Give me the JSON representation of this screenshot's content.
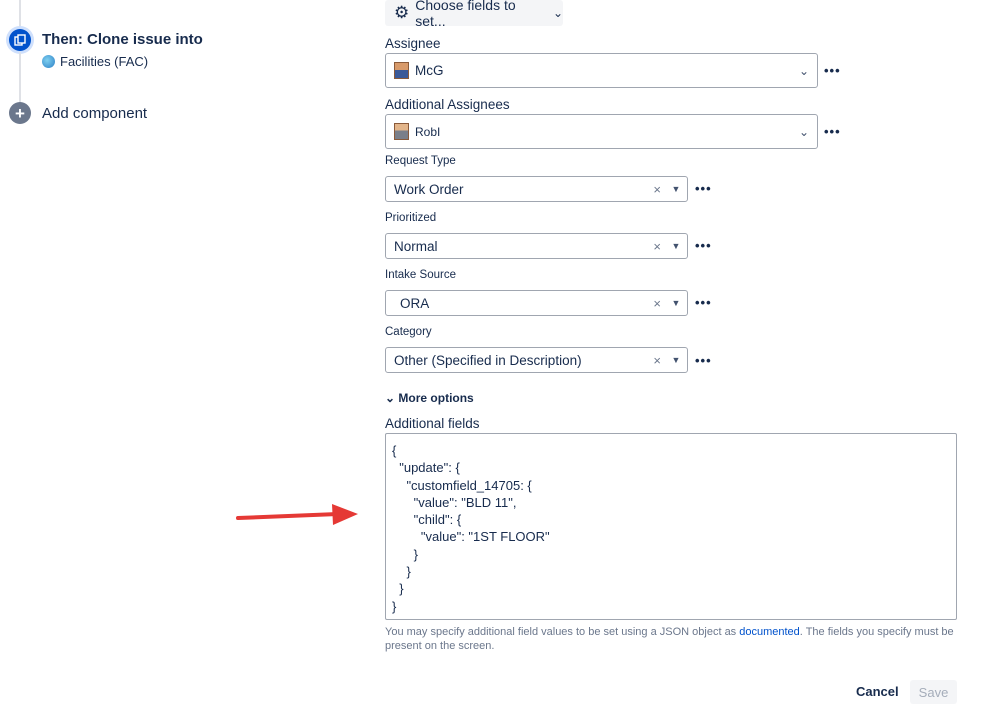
{
  "sidebar": {
    "step_title": "Then: Clone issue into",
    "project": "Facilities (FAC)",
    "add_component": "Add component"
  },
  "toolbar": {
    "choose_fields": "Choose fields to set..."
  },
  "fields": {
    "assignee": {
      "label": "Assignee",
      "value": "McG"
    },
    "additional_assignees": {
      "label": "Additional Assignees",
      "value": "RobI"
    },
    "request_type": {
      "label": "Request Type",
      "value": "Work Order"
    },
    "prioritized": {
      "label": "Prioritized",
      "value": "Normal"
    },
    "intake_source": {
      "label": "Intake Source",
      "value": "ORA"
    },
    "category": {
      "label": "Category",
      "value": "Other (Specified in Description)"
    }
  },
  "more_options": "More options",
  "additional_fields": {
    "label": "Additional fields",
    "lines": [
      "{",
      "  \"update\": {",
      "    \"customfield_14705: {",
      "      \"value\": \"BLD 11\",",
      "      \"child\": {",
      "        \"value\": \"1ST FLOOR\"",
      "      }",
      "    }",
      "  }",
      "}"
    ]
  },
  "help": {
    "before": "You may specify additional field values to be set using a JSON object as ",
    "link": "documented",
    "after": ". The fields you specify must be present on the screen."
  },
  "actions": {
    "cancel": "Cancel",
    "save": "Save"
  },
  "colors": {
    "accent": "#0052cc",
    "arrow": "#e53935"
  }
}
